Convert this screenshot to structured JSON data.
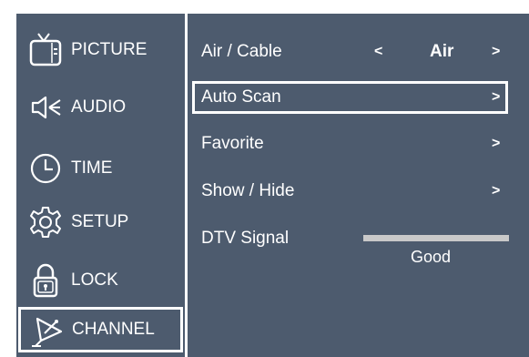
{
  "sidebar": {
    "items": [
      {
        "label": "PICTURE",
        "icon": "tv-icon"
      },
      {
        "label": "AUDIO",
        "icon": "speaker-icon"
      },
      {
        "label": "TIME",
        "icon": "clock-icon"
      },
      {
        "label": "SETUP",
        "icon": "gear-icon"
      },
      {
        "label": "LOCK",
        "icon": "padlock-icon"
      },
      {
        "label": "CHANNEL",
        "icon": "satellite-dish-icon"
      }
    ],
    "active": "CHANNEL"
  },
  "menu": {
    "air_cable": {
      "label": "Air / Cable",
      "value": "Air",
      "left_arrow": "<",
      "right_arrow": ">"
    },
    "auto_scan": {
      "label": "Auto Scan",
      "arrow": ">"
    },
    "favorite": {
      "label": "Favorite",
      "arrow": ">"
    },
    "show_hide": {
      "label": "Show / Hide",
      "arrow": ">"
    },
    "dtv_signal": {
      "label": "DTV Signal",
      "status": "Good"
    }
  },
  "colors": {
    "background": "#4d5b6e",
    "text": "#ffffff",
    "signal_bar": "#c9c9c9"
  }
}
